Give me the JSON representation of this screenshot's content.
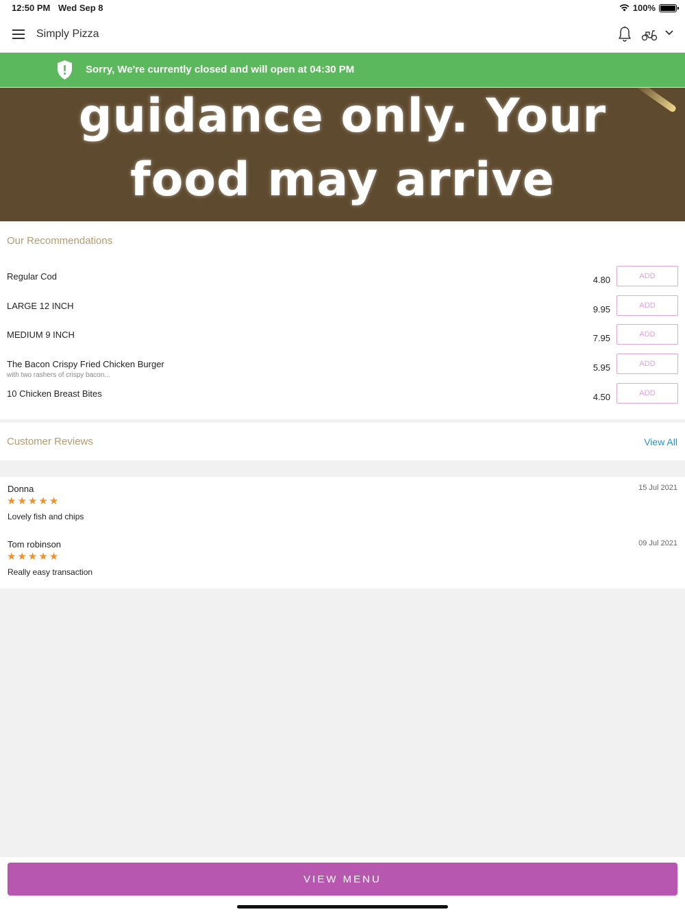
{
  "status_bar": {
    "time": "12:50 PM",
    "date": "Wed Sep 8",
    "battery": "100%"
  },
  "header": {
    "title": "Simply Pizza"
  },
  "closed_banner": {
    "text": "Sorry, We're currently closed and will open at 04:30 PM",
    "color": "#5cb85c"
  },
  "hero": {
    "line1": "guidance only. Your",
    "line2": "food may arrive"
  },
  "recommendations": {
    "title": "Our Recommendations",
    "add_label": "ADD",
    "items": [
      {
        "name": "Regular Cod",
        "desc": "",
        "price": "4.80"
      },
      {
        "name": "LARGE 12 INCH",
        "desc": "",
        "price": "9.95"
      },
      {
        "name": "MEDIUM 9 INCH",
        "desc": "",
        "price": "7.95"
      },
      {
        "name": "The Bacon Crispy Fried Chicken Burger",
        "desc": "with two rashers of crispy bacon...",
        "price": "5.95"
      },
      {
        "name": "10 Chicken Breast Bites",
        "desc": "",
        "price": "4.50"
      }
    ]
  },
  "reviews": {
    "title": "Customer Reviews",
    "view_all": "View All",
    "items": [
      {
        "name": "Donna",
        "date": "15 Jul 2021",
        "rating": 5,
        "text": "Lovely fish and chips"
      },
      {
        "name": "Tom robinson",
        "date": "09 Jul 2021",
        "rating": 5,
        "text": "Really easy transaction"
      }
    ]
  },
  "footer": {
    "button": "VIEW MENU",
    "color": "#b857b0"
  }
}
